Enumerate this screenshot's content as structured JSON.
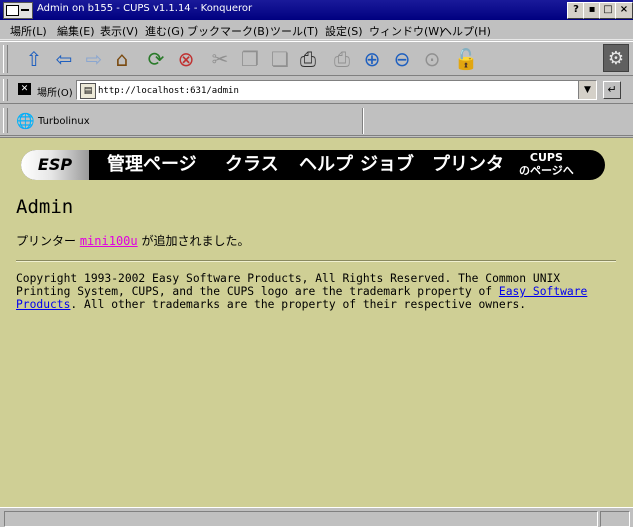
{
  "window": {
    "title": "Admin on b155 - CUPS v1.1.14 - Konqueror",
    "buttons": {
      "help": "?",
      "minimize": "▪",
      "maximize": "□",
      "close": "×"
    }
  },
  "menu": [
    "場所(L)",
    "編集(E)",
    "表示(V)",
    "進む(G)",
    "ブックマーク(B)",
    "ツール(T)",
    "設定(S)",
    "ウィンドウ(W)",
    "ヘルプ(H)"
  ],
  "toolbar": {
    "icons": {
      "up": "⇧",
      "back": "⇦",
      "forward": "⇨",
      "home": "⌂",
      "reload": "⟳",
      "stop": "⊗",
      "cut": "✂",
      "copy": "❐",
      "paste": "❏",
      "print": "⎙",
      "print_frame": "⎙",
      "zoom_in": "⊕",
      "zoom_out": "⊖",
      "zoom_disabled": "⊙",
      "security": "🔓",
      "konqueror": "⚙"
    }
  },
  "location": {
    "clear_icon": "✕",
    "label": "場所(O)",
    "url": "http://localhost:631/admin",
    "page_icon": "▤",
    "dropdown_icon": "▼",
    "go_icon": "↵"
  },
  "bookmarks": [
    {
      "label": "Turbolinux",
      "icon": "🌐"
    }
  ],
  "page": {
    "banner": {
      "logo": "ESP",
      "nav": [
        "管理ページ",
        "クラス",
        "ヘルプ",
        "ジョブ",
        "プリンタ"
      ],
      "cups_line1": "CUPS",
      "cups_line2": "のページへ"
    },
    "heading": "Admin",
    "message_before": "プリンター ",
    "printer_link": "mini100u",
    "message_after": " が追加されました。",
    "copyright_text": "Copyright 1993-2002 Easy Software Products, All Rights Reserved. The Common UNIX Printing System, CUPS, and the CUPS logo are the trademark property of ",
    "copyright_link": "Easy Software Products",
    "copyright_tail": ". All other trademarks are the property of their respective owners."
  },
  "colors": {
    "titlebar": "#000080",
    "page_background": "#cfcf95",
    "link": "#0000ee",
    "visited_link": "#e000e0"
  }
}
